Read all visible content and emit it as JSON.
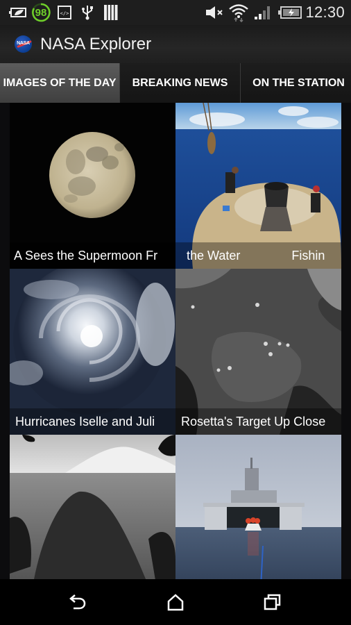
{
  "status_bar": {
    "battery_saver_icon": "leaf-battery-icon",
    "battery_meter_value": "98",
    "developer_icon": "code-icon",
    "usb_icon": "usb-icon",
    "notification_icon": "barcode-icon",
    "mute_icon": "volume-muted-icon",
    "wifi_icon": "wifi-icon",
    "signal_icon": "signal-bars-icon",
    "battery_icon": "battery-charging-icon",
    "time": "12:30"
  },
  "action_bar": {
    "logo_text": "NASA",
    "title": "NASA Explorer"
  },
  "tabs": [
    {
      "label": "IMAGES OF THE DAY",
      "active": true
    },
    {
      "label": "BREAKING NEWS",
      "active": false
    },
    {
      "label": "ON THE STATION",
      "active": false
    }
  ],
  "tiles": [
    {
      "caption": "NASA Sees the Supermoon From Space",
      "visible_caption": "A Sees the Supermoon Fr",
      "image": "full-moon"
    },
    {
      "caption": "the Water   Fishin",
      "visible_caption": "the Water          Fishin",
      "image": "spacecraft-recovery-at-sea"
    },
    {
      "caption": "Hurricanes Iselle and Julio",
      "visible_caption": "Hurricanes Iselle and Juli",
      "image": "hurricane-satellite"
    },
    {
      "caption": "Rosetta's Target Up Close",
      "visible_caption": "Rosetta's Target Up Close",
      "image": "comet-surface"
    },
    {
      "caption": "",
      "visible_caption": "",
      "image": "mars-rover-shadow"
    },
    {
      "caption": "",
      "visible_caption": "",
      "image": "navy-ship-orion-capsule"
    }
  ],
  "nav_bar": {
    "back": "back-icon",
    "home": "home-icon",
    "recents": "recent-apps-icon"
  },
  "colors": {
    "battery_green": "#6fcf2a",
    "tab_active": "#4a4a4a",
    "background": "#0c0c0e"
  }
}
